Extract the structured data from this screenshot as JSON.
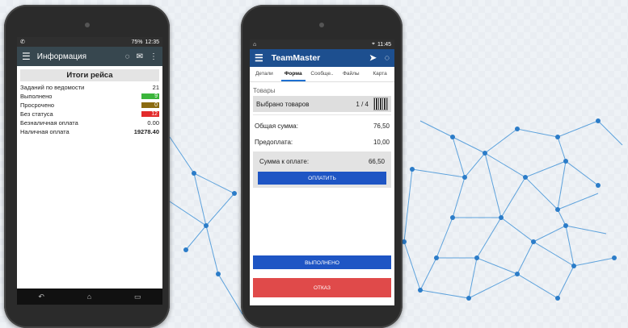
{
  "phone1": {
    "status_time": "12:35",
    "status_battery": "75%",
    "appbar_title": "Информация",
    "panel_title": "Итоги рейса",
    "rows": [
      {
        "label": "Заданий по ведомости",
        "value": "21",
        "color": ""
      },
      {
        "label": "Выполнено",
        "value": "9",
        "color": "#3bb53b"
      },
      {
        "label": "Просрочено",
        "value": "0",
        "color": "#8b6b10"
      },
      {
        "label": "Без статуса",
        "value": "12",
        "color": "#e32b2b"
      },
      {
        "label": "Безналичная оплата",
        "value": "0.00",
        "color": ""
      },
      {
        "label": "Наличная оплата",
        "value": "19278.40",
        "color": ""
      }
    ]
  },
  "phone2": {
    "status_time": "11:45",
    "appbar_title": "TeamMaster",
    "tabs": [
      "Детали",
      "Форма",
      "Сообще..",
      "Файлы",
      "Карта"
    ],
    "active_tab": "Форма",
    "section_label": "Товары",
    "goods_label": "Выбрано товаров",
    "goods_count": "1 / 4",
    "total_label": "Общая сумма:",
    "total_value": "76,50",
    "prepay_label": "Предоплата:",
    "prepay_value": "10,00",
    "due_label": "Сумма к оплате:",
    "due_value": "66,50",
    "pay_button": "ОПЛАТИТЬ",
    "done_button": "ВЫПОЛНЕНО",
    "refuse_button": "ОТКАЗ"
  },
  "colors": {
    "appbar1": "#37474f",
    "appbar2": "#1d4f8f",
    "primary_button": "#1e55c4",
    "danger_button": "#e04a4a"
  }
}
